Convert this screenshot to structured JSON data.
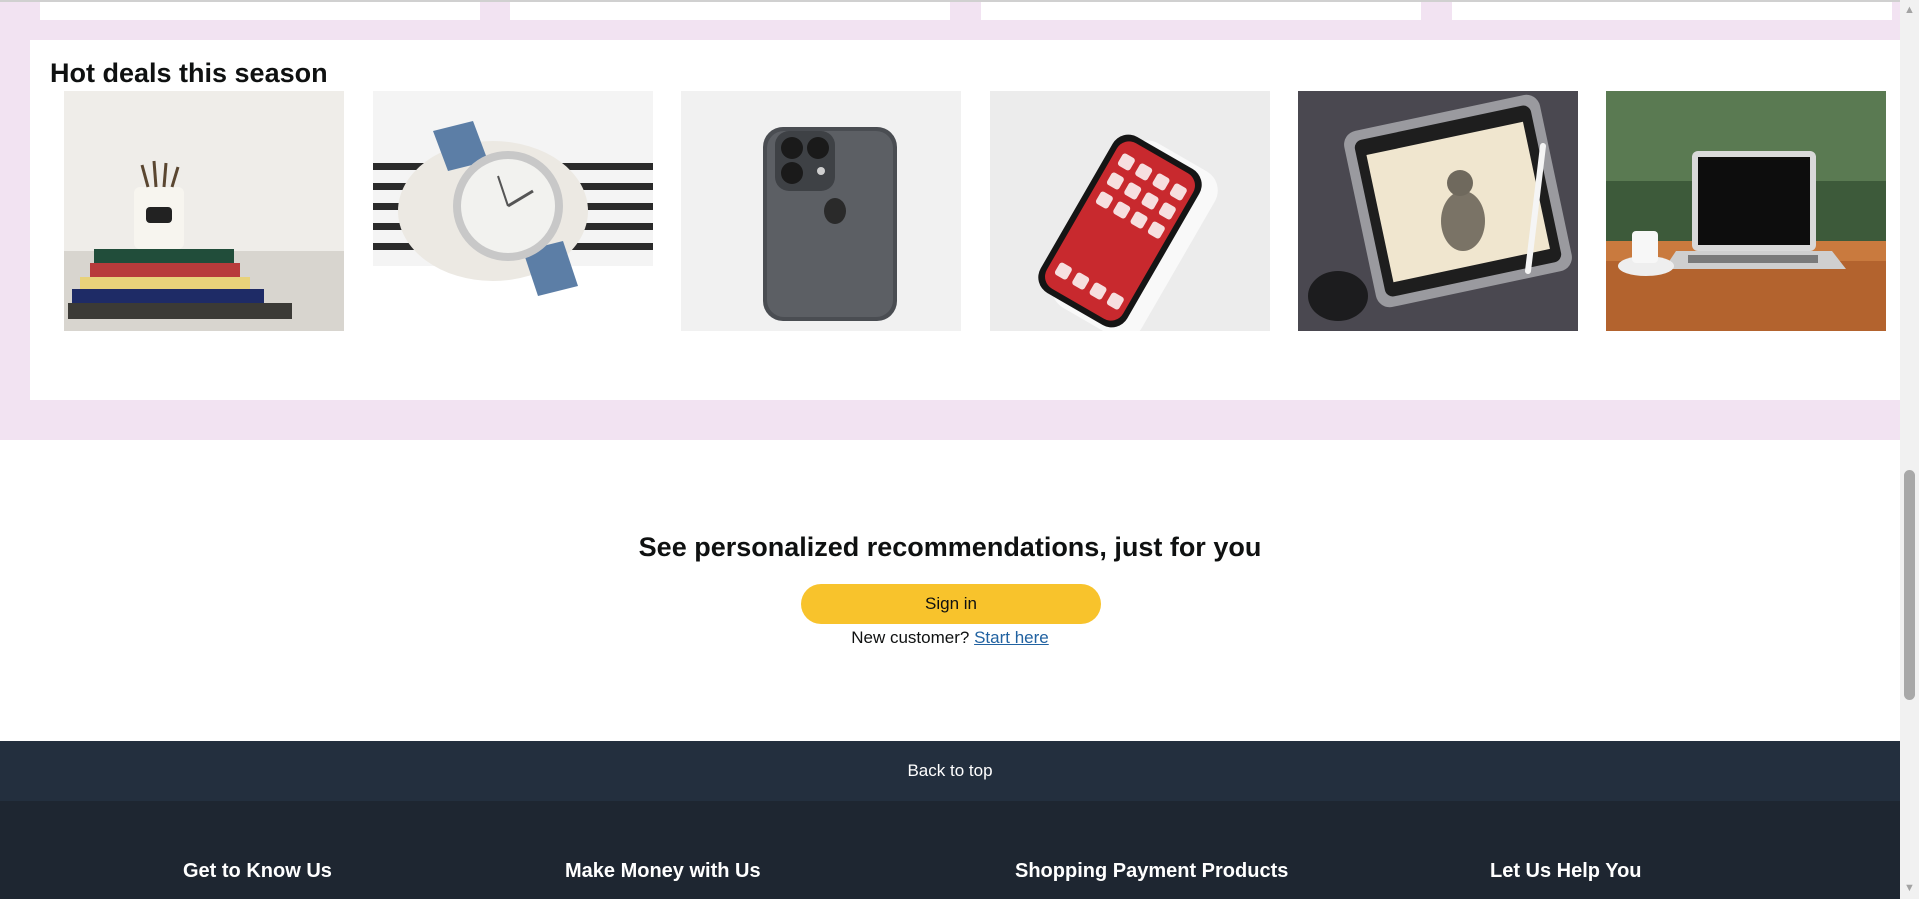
{
  "deals": {
    "title": "Hot deals this season",
    "items": [
      {
        "name": "books-image",
        "alt": "Stack of books with pencil holder"
      },
      {
        "name": "watch-image",
        "alt": "Wristwatch with blue strap"
      },
      {
        "name": "phone-back-image",
        "alt": "Smartphone back with triple camera"
      },
      {
        "name": "phone-front-image",
        "alt": "Smartphone screen with apps"
      },
      {
        "name": "tablet-image",
        "alt": "Tablet with stylus showing cat drawing"
      },
      {
        "name": "laptop-image",
        "alt": "Laptop on wooden table with coffee cup"
      }
    ]
  },
  "recommendations": {
    "title": "See personalized recommendations, just for you",
    "signin_label": "Sign in",
    "new_customer_text": "New customer?",
    "start_here_label": "Start here"
  },
  "back_to_top": "Back to top",
  "footer": {
    "columns": [
      "Get to Know Us",
      "Make Money with Us",
      "Shopping Payment Products",
      "Let Us Help You"
    ]
  },
  "colors": {
    "pink_band": "#f2e3f2",
    "signin_button": "#f8c32c",
    "back_to_top_bg": "#232f3e",
    "footer_bg": "#1e2631",
    "link": "#2162a1"
  }
}
